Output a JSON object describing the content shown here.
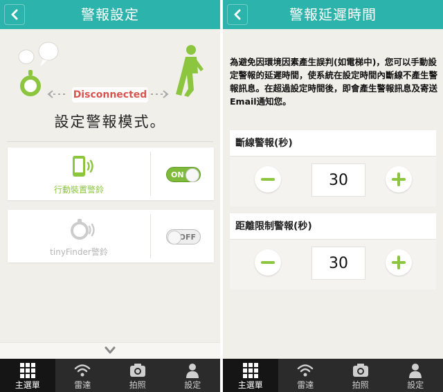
{
  "colors": {
    "header": "#2cb3ab",
    "accent_green": "#8cc63f",
    "disconnected_red": "#d9534f",
    "tabbar": "#2b2b2b",
    "background": "#f1efe9"
  },
  "left": {
    "header": {
      "title": "警報設定",
      "back_icon": "chevron-left-icon"
    },
    "status_label": "Disconnected",
    "mode_title": "設定警報模式。",
    "alarms": [
      {
        "label": "行動裝置警鈴",
        "icon": "phone-ring-icon",
        "toggle": "ON",
        "enabled": true
      },
      {
        "label": "tinyFinder警鈴",
        "icon": "finder-ring-icon",
        "toggle": "OFF",
        "enabled": false
      }
    ],
    "scroll_icon": "chevron-down-icon"
  },
  "right": {
    "header": {
      "title": "警報延遲時間",
      "back_icon": "chevron-left-icon"
    },
    "description": "為避免因環境因素產生誤判(如電梯中)，您可以手動設定警報的延遲時間，使系統在設定時間內斷線不產生警報訊息。在超過設定時間後，即會產生警報訊息及寄送Email通知您。",
    "delays": [
      {
        "label": "斷線警報(秒)",
        "value": "30"
      },
      {
        "label": "距離限制警報(秒)",
        "value": "30"
      }
    ]
  },
  "tabs": [
    {
      "label": "主選單",
      "icon": "grid-icon",
      "active": true
    },
    {
      "label": "雷達",
      "icon": "wifi-icon",
      "active": false
    },
    {
      "label": "拍照",
      "icon": "camera-icon",
      "active": false
    },
    {
      "label": "設定",
      "icon": "person-icon",
      "active": false
    }
  ]
}
